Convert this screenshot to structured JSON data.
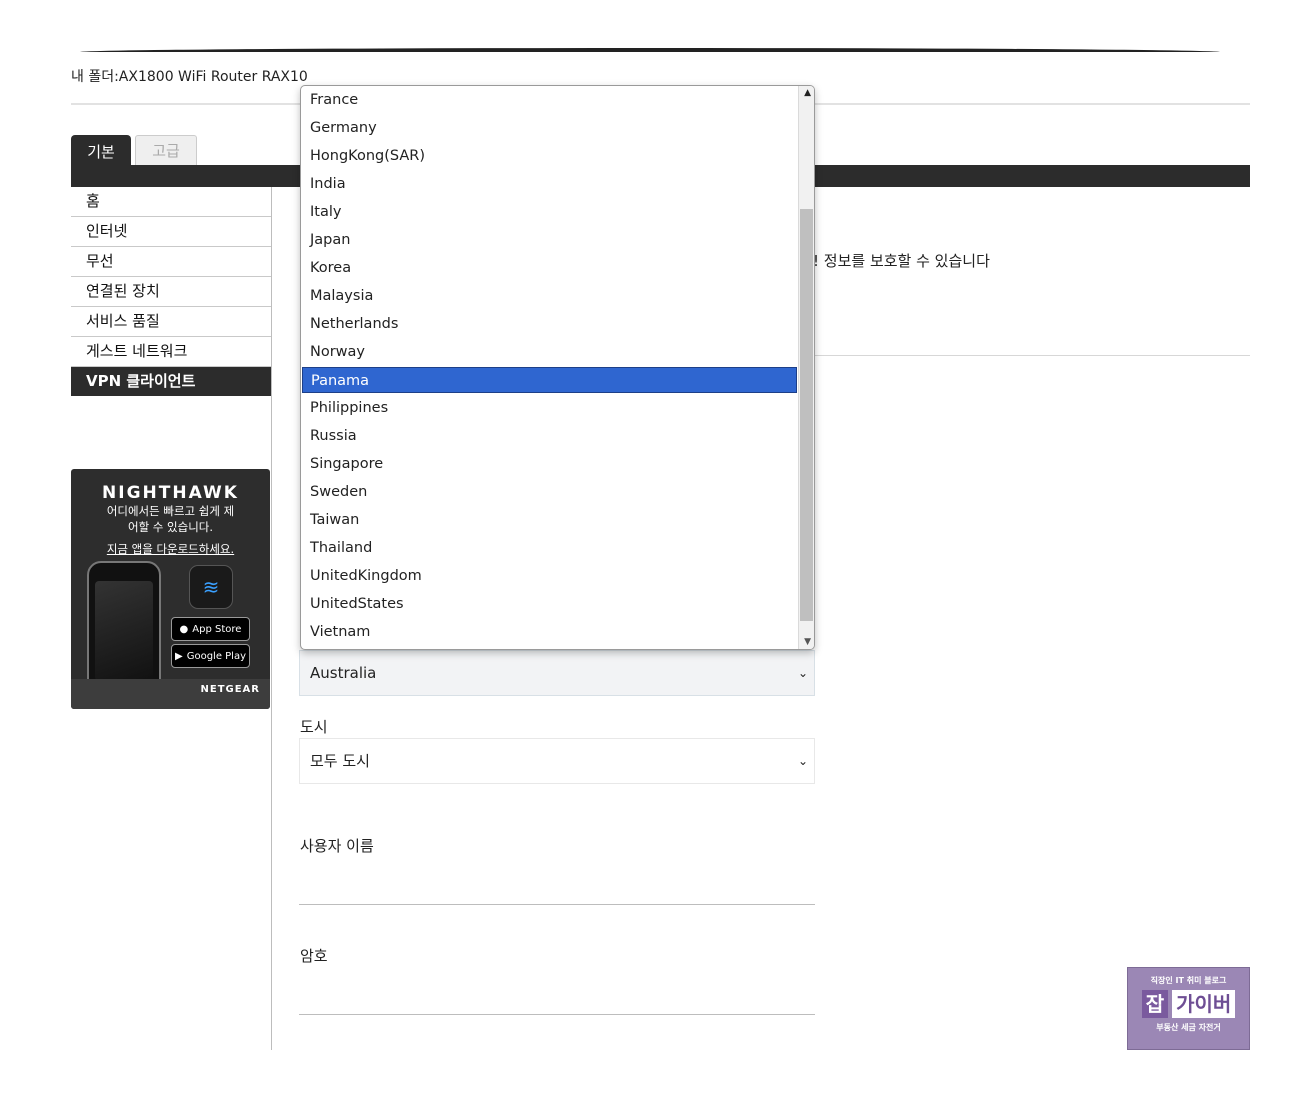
{
  "breadcrumb": "내 폴더:AX1800 WiFi Router RAX10",
  "tabs": {
    "basic": "기본",
    "advanced": "고급"
  },
  "sidebar": {
    "items": [
      {
        "label": "홈"
      },
      {
        "label": "인터넷"
      },
      {
        "label": "무선"
      },
      {
        "label": "연결된 장치"
      },
      {
        "label": "서비스 품질"
      },
      {
        "label": "게스트 네트워크"
      },
      {
        "label": "VPN 클라이언트"
      }
    ]
  },
  "promo": {
    "brand": "NIGHTHAWK",
    "line1": "어디에서든 빠르고 쉽게 제",
    "line2": "어할 수 있습니다.",
    "link": "지금 앱을 다운로드하세요.",
    "app_store": "App Store",
    "google_play": "Google Play",
    "netgear": "NETGEAR"
  },
  "main": {
    "partial_text": "! 정보를 보호할 수 있습니다",
    "country_value": "Australia",
    "city_label": "도시",
    "city_value": "모두 도시",
    "username_label": "사용자 이름",
    "password_label": "암호"
  },
  "dropdown": {
    "options": [
      "France",
      "Germany",
      "HongKong(SAR)",
      "India",
      "Italy",
      "Japan",
      "Korea",
      "Malaysia",
      "Netherlands",
      "Norway",
      "Panama",
      "Philippines",
      "Russia",
      "Singapore",
      "Sweden",
      "Taiwan",
      "Thailand",
      "UnitedKingdom",
      "UnitedStates",
      "Vietnam"
    ],
    "highlighted": "Panama"
  },
  "watermark": {
    "top": "직장인 IT 취미 블로그",
    "jab": "잡",
    "gaiver": "가이버",
    "bottom": "부동산 세금 자전거"
  },
  "icons": {
    "dropdown_chevron": "chevron-down-icon",
    "scroll_up": "arrow-up-icon",
    "scroll_down": "arrow-down-icon"
  }
}
